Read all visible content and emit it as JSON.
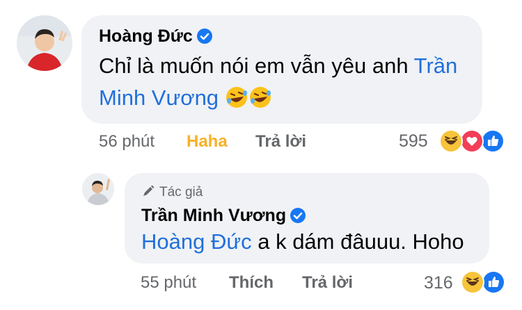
{
  "comment1": {
    "author": "Hoàng Đức",
    "text_before": "Chỉ là muốn nói em vẫn yêu anh ",
    "mention_line1": "Trần",
    "mention_line2": "Minh Vương",
    "emoji": [
      "rolling-laughing",
      "rolling-laughing"
    ],
    "time": "56 phút",
    "reaction_label": "Haha",
    "reply_label": "Trả lời",
    "reaction_count": "595",
    "reaction_icons": [
      "haha",
      "love",
      "like"
    ]
  },
  "reply1": {
    "author_label": "Tác giả",
    "author": "Trần Minh Vương",
    "mention": "Hoàng Đức",
    "text": " a k dám đâuuu. Hoho",
    "time": "55 phút",
    "like_label": "Thích",
    "reply_label": "Trả lời",
    "reaction_count": "316",
    "reaction_icons": [
      "haha",
      "like"
    ]
  },
  "colors": {
    "mention": "#216fdb",
    "haha": "#f7b125",
    "bubble": "#f0f2f5",
    "meta": "#65676b",
    "verified": "#1877f2"
  }
}
